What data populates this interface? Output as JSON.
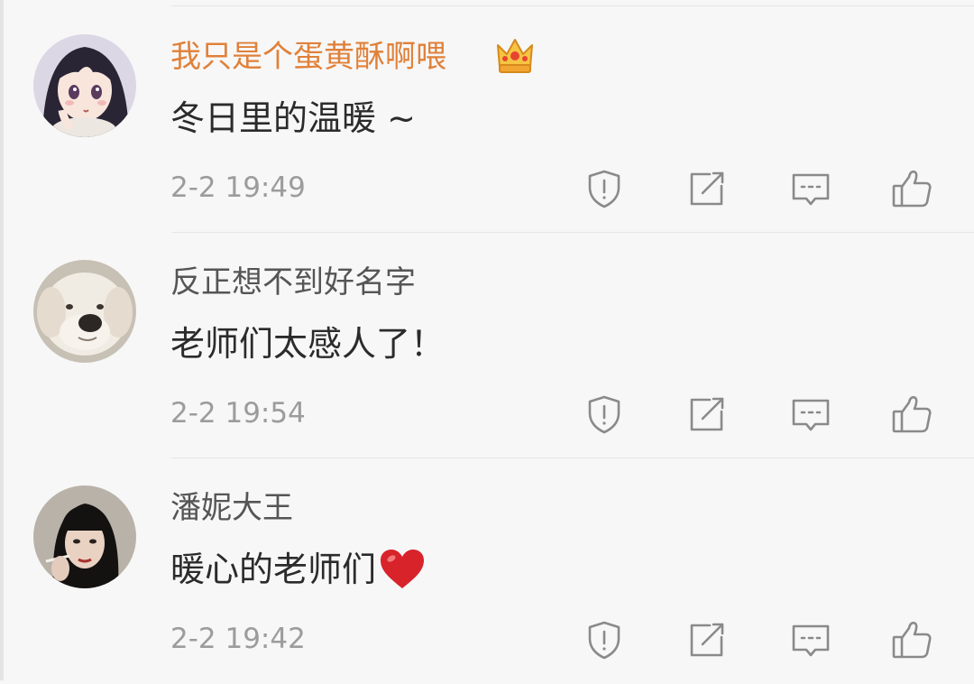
{
  "comments": [
    {
      "username": "我只是个蛋黄酥啊喂",
      "vip": true,
      "content": "冬日里的温暖 ~",
      "time": "2-2 19:49",
      "avatar": "anime-girl-avatar"
    },
    {
      "username": "反正想不到好名字",
      "vip": false,
      "content": "老师们太感人了！",
      "time": "2-2 19:54",
      "avatar": "white-dog-avatar"
    },
    {
      "username": "潘妮大王",
      "vip": false,
      "content": "暖心的老师们",
      "content_emoji": "red-heart-emoji",
      "time": "2-2 19:42",
      "avatar": "woman-bob-hair-avatar"
    }
  ],
  "icons": {
    "vip_badge": "crown-icon",
    "report": "shield-alert-icon",
    "share": "share-icon",
    "reply": "comment-icon",
    "like": "thumbs-up-icon"
  },
  "colors": {
    "background": "#f7f7f7",
    "vip_username": "#e0813a",
    "username": "#555555",
    "content": "#2b2b2b",
    "timestamp": "#9c9c9c",
    "icon": "#8a8a8a",
    "heart": "#d8232a"
  }
}
